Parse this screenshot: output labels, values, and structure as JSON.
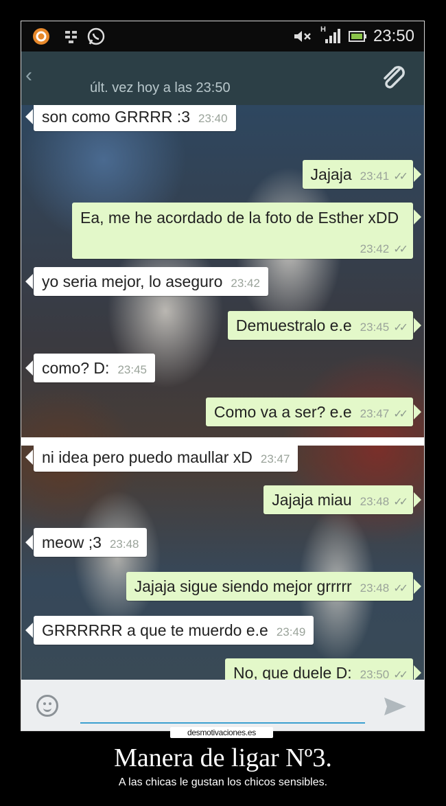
{
  "status_bar": {
    "time": "23:50",
    "icons": [
      "app-icon",
      "bb-icon",
      "whatsapp-icon",
      "mute-icon",
      "signal-icon",
      "battery-icon"
    ],
    "network_label": "H"
  },
  "header": {
    "last_seen": "últ. vez hoy a las 23:50",
    "back_glyph": "‹",
    "colors": {
      "action_bar": "#2c3f46"
    }
  },
  "messages": [
    {
      "dir": "in",
      "text": "son como GRRRR :3",
      "time": "23:40",
      "ticks": ""
    },
    {
      "dir": "out",
      "text": "Jajaja",
      "time": "23:41",
      "ticks": "✓✓"
    },
    {
      "dir": "out",
      "text": "Ea, me he acordado de la foto de Esther xDD",
      "time": "23:42",
      "ticks": "✓✓"
    },
    {
      "dir": "in",
      "text": "yo seria mejor, lo aseguro",
      "time": "23:42",
      "ticks": ""
    },
    {
      "dir": "out",
      "text": "Demuestralo e.e",
      "time": "23:45",
      "ticks": "✓✓"
    },
    {
      "dir": "in",
      "text": "como? D:",
      "time": "23:45",
      "ticks": ""
    },
    {
      "dir": "out",
      "text": "Como va a ser? e.e",
      "time": "23:47",
      "ticks": "✓✓"
    },
    {
      "dir": "in",
      "text": "ni idea pero puedo maullar xD",
      "time": "23:47",
      "ticks": ""
    },
    {
      "dir": "out",
      "text": "Jajaja miau",
      "time": "23:48",
      "ticks": "✓✓"
    },
    {
      "dir": "in",
      "text": "meow ;3",
      "time": "23:48",
      "ticks": ""
    },
    {
      "dir": "out",
      "text": "Jajaja sigue siendo mejor grrrrr",
      "time": "23:48",
      "ticks": "✓✓"
    },
    {
      "dir": "in",
      "text": "GRRRRRR a que te muerdo e.e",
      "time": "23:49",
      "ticks": ""
    },
    {
      "dir": "out",
      "text": "No, que duele D:",
      "time": "23:50",
      "ticks": "✓✓"
    }
  ],
  "composer": {
    "emoji_icon": "emoji-icon",
    "send_icon": "send-icon",
    "accent": "#3ba0d0"
  },
  "poster": {
    "watermark": "desmotivaciones.es",
    "title": "Manera de ligar Nº3.",
    "subtitle": "A las chicas le gustan los chicos sensibles."
  }
}
